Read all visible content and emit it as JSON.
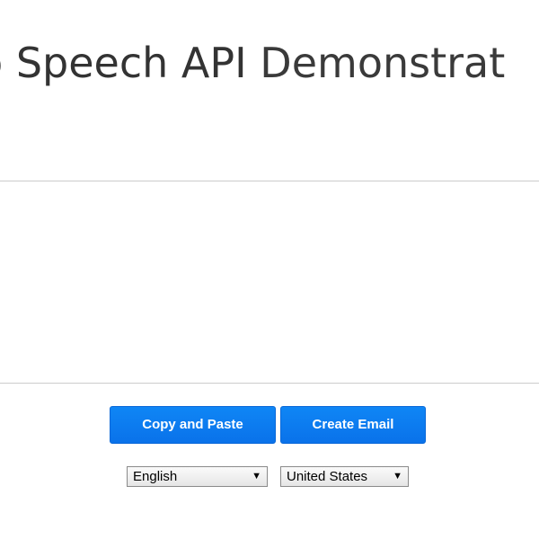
{
  "header": {
    "title_part1": "b Speech API",
    "title_part2": " Demonstrat"
  },
  "buttons": {
    "copy_label": "Copy and Paste",
    "email_label": "Create Email"
  },
  "language_select": {
    "selected": "English",
    "arrow": "▼"
  },
  "dialect_select": {
    "selected": "United States",
    "arrow": "▼"
  },
  "colors": {
    "button_blue": "#0a72ea",
    "divider": "#cccccc"
  },
  "icons": {
    "dropdown": "chevron-down-icon"
  }
}
